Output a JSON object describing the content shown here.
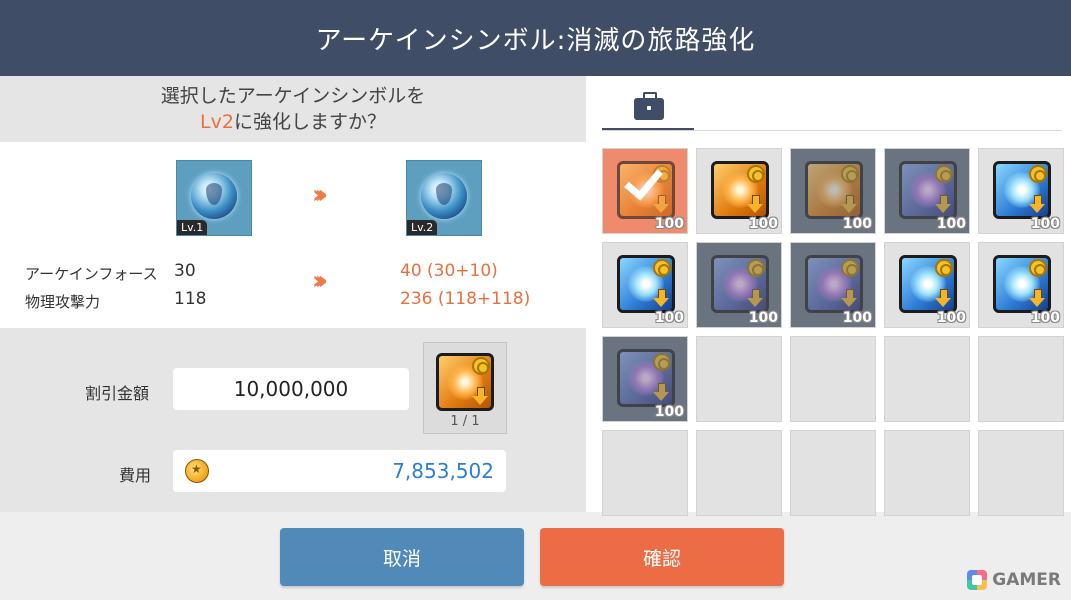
{
  "header": {
    "title": "アーケインシンボル:消滅の旅路強化"
  },
  "question": {
    "line1": "選択したアーケインシンボルを",
    "level": "Lv2",
    "line2_rest": "に強化しますか？"
  },
  "symbols": {
    "current_level": "Lv.1",
    "next_level": "Lv.2",
    "arrow": "»"
  },
  "stats": [
    {
      "label": "アーケインフォース",
      "current": "30",
      "next": "40 (30+10)"
    },
    {
      "label": "物理攻撃力",
      "current": "118",
      "next": "236 (118+118)"
    }
  ],
  "discount": {
    "label": "割引金額",
    "value": "10,000,000",
    "item_count": "1 / 1"
  },
  "cost": {
    "label": "費用",
    "value": "7,853,502"
  },
  "buttons": {
    "cancel": "取消",
    "confirm": "確認"
  },
  "inventory": {
    "tab_icon": "bag-icon",
    "slots": [
      {
        "kind": "orange",
        "qty": "100",
        "state": "selected"
      },
      {
        "kind": "orange",
        "qty": "100",
        "state": "normal"
      },
      {
        "kind": "orange",
        "qty": "100",
        "state": "disabled"
      },
      {
        "kind": "purple",
        "qty": "100",
        "state": "disabled"
      },
      {
        "kind": "blue",
        "qty": "100",
        "state": "normal"
      },
      {
        "kind": "blue",
        "qty": "100",
        "state": "normal"
      },
      {
        "kind": "purple",
        "qty": "100",
        "state": "disabled"
      },
      {
        "kind": "purple",
        "qty": "100",
        "state": "disabled"
      },
      {
        "kind": "blue",
        "qty": "100",
        "state": "normal"
      },
      {
        "kind": "blue",
        "qty": "100",
        "state": "normal"
      },
      {
        "kind": "purple",
        "qty": "100",
        "state": "disabled"
      }
    ]
  },
  "watermark": {
    "text": "GAMER"
  },
  "colors": {
    "header": "#3f4d66",
    "accent": "#e8703f",
    "cancel": "#5189b8",
    "confirm": "#ec6c46",
    "cost_text": "#2a7fd4"
  }
}
